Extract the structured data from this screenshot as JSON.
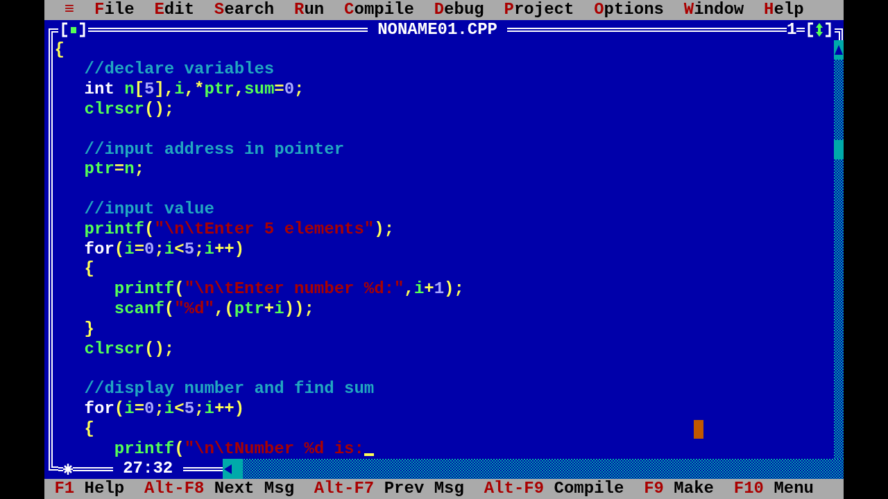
{
  "menu": {
    "system_menu": "≡",
    "items": [
      {
        "label": "File"
      },
      {
        "label": "Edit"
      },
      {
        "label": "Search"
      },
      {
        "label": "Run"
      },
      {
        "label": "Compile"
      },
      {
        "label": "Debug"
      },
      {
        "label": "Project"
      },
      {
        "label": "Options"
      },
      {
        "label": "Window"
      },
      {
        "label": "Help"
      }
    ]
  },
  "editor": {
    "title": "NONAME01.CPP",
    "number": "1",
    "modified": true,
    "cursor_position": "27:32",
    "lines": [
      {
        "kind": "code",
        "cursor": false,
        "tokens": [
          {
            "kind": "symbol",
            "text": "{"
          }
        ],
        "children": [
          {
            "kind": "code",
            "cursor": false,
            "tokens": [
              {
                "kind": "comment",
                "text": "//declare variables"
              }
            ]
          },
          {
            "kind": "code",
            "cursor": false,
            "tokens": [
              {
                "kind": "keyword",
                "text": "int"
              },
              {
                "kind": "space"
              },
              {
                "kind": "identifier",
                "text": "n"
              },
              {
                "kind": "symbol",
                "text": "["
              },
              {
                "kind": "number",
                "text": "5"
              },
              {
                "kind": "symbol",
                "text": "],"
              },
              {
                "kind": "identifier",
                "text": "i"
              },
              {
                "kind": "symbol",
                "text": ",*"
              },
              {
                "kind": "identifier",
                "text": "ptr"
              },
              {
                "kind": "symbol",
                "text": ","
              },
              {
                "kind": "identifier",
                "text": "sum"
              },
              {
                "kind": "symbol",
                "text": "="
              },
              {
                "kind": "number",
                "text": "0"
              },
              {
                "kind": "symbol",
                "text": ";"
              }
            ]
          },
          {
            "kind": "code",
            "cursor": false,
            "tokens": [
              {
                "kind": "identifier",
                "text": "clrscr"
              },
              {
                "kind": "symbol",
                "text": "();"
              }
            ]
          },
          {
            "kind": "blank"
          },
          {
            "kind": "code",
            "cursor": false,
            "tokens": [
              {
                "kind": "comment",
                "text": "//input address in pointer"
              }
            ]
          },
          {
            "kind": "code",
            "cursor": false,
            "tokens": [
              {
                "kind": "identifier",
                "text": "ptr"
              },
              {
                "kind": "symbol",
                "text": "="
              },
              {
                "kind": "identifier",
                "text": "n"
              },
              {
                "kind": "symbol",
                "text": ";"
              }
            ]
          },
          {
            "kind": "blank"
          },
          {
            "kind": "code",
            "cursor": false,
            "tokens": [
              {
                "kind": "comment",
                "text": "//input value"
              }
            ]
          },
          {
            "kind": "code",
            "cursor": false,
            "tokens": [
              {
                "kind": "identifier",
                "text": "printf"
              },
              {
                "kind": "symbol",
                "text": "("
              },
              {
                "kind": "string",
                "text": "\"\\n\\tEnter 5 elements\""
              },
              {
                "kind": "symbol",
                "text": ");"
              }
            ]
          },
          {
            "kind": "code",
            "cursor": false,
            "tokens": [
              {
                "kind": "keyword",
                "text": "for"
              },
              {
                "kind": "symbol",
                "text": "("
              },
              {
                "kind": "identifier",
                "text": "i"
              },
              {
                "kind": "symbol",
                "text": "="
              },
              {
                "kind": "number",
                "text": "0"
              },
              {
                "kind": "symbol",
                "text": ";"
              },
              {
                "kind": "identifier",
                "text": "i"
              },
              {
                "kind": "symbol",
                "text": "<"
              },
              {
                "kind": "number",
                "text": "5"
              },
              {
                "kind": "symbol",
                "text": ";"
              },
              {
                "kind": "identifier",
                "text": "i"
              },
              {
                "kind": "symbol",
                "text": "++)"
              }
            ]
          },
          {
            "kind": "code",
            "cursor": false,
            "tokens": [
              {
                "kind": "symbol",
                "text": "{"
              }
            ],
            "children": [
              {
                "kind": "code",
                "cursor": false,
                "tokens": [
                  {
                    "kind": "identifier",
                    "text": "printf"
                  },
                  {
                    "kind": "symbol",
                    "text": "("
                  },
                  {
                    "kind": "string",
                    "text": "\"\\n\\tEnter number %d:\""
                  },
                  {
                    "kind": "symbol",
                    "text": ","
                  },
                  {
                    "kind": "identifier",
                    "text": "i"
                  },
                  {
                    "kind": "symbol",
                    "text": "+"
                  },
                  {
                    "kind": "number",
                    "text": "1"
                  },
                  {
                    "kind": "symbol",
                    "text": ");"
                  }
                ]
              },
              {
                "kind": "code",
                "cursor": false,
                "tokens": [
                  {
                    "kind": "identifier",
                    "text": "scanf"
                  },
                  {
                    "kind": "symbol",
                    "text": "("
                  },
                  {
                    "kind": "string",
                    "text": "\"%d\""
                  },
                  {
                    "kind": "symbol",
                    "text": ",("
                  },
                  {
                    "kind": "identifier",
                    "text": "ptr"
                  },
                  {
                    "kind": "symbol",
                    "text": "+"
                  },
                  {
                    "kind": "identifier",
                    "text": "i"
                  },
                  {
                    "kind": "symbol",
                    "text": "));"
                  }
                ]
              }
            ]
          },
          {
            "kind": "code",
            "cursor": false,
            "tokens": [
              {
                "kind": "symbol",
                "text": "}"
              }
            ]
          },
          {
            "kind": "code",
            "cursor": false,
            "tokens": [
              {
                "kind": "identifier",
                "text": "clrscr"
              },
              {
                "kind": "symbol",
                "text": "();"
              }
            ]
          },
          {
            "kind": "blank"
          },
          {
            "kind": "code",
            "cursor": false,
            "tokens": [
              {
                "kind": "comment",
                "text": "//display number and find sum"
              }
            ]
          },
          {
            "kind": "code",
            "cursor": false,
            "tokens": [
              {
                "kind": "keyword",
                "text": "for"
              },
              {
                "kind": "symbol",
                "text": "("
              },
              {
                "kind": "identifier",
                "text": "i"
              },
              {
                "kind": "symbol",
                "text": "="
              },
              {
                "kind": "number",
                "text": "0"
              },
              {
                "kind": "symbol",
                "text": ";"
              },
              {
                "kind": "identifier",
                "text": "i"
              },
              {
                "kind": "symbol",
                "text": "<"
              },
              {
                "kind": "number",
                "text": "5"
              },
              {
                "kind": "symbol",
                "text": ";"
              },
              {
                "kind": "identifier",
                "text": "i"
              },
              {
                "kind": "symbol",
                "text": "++)"
              }
            ]
          },
          {
            "kind": "code",
            "cursor": false,
            "tokens": [
              {
                "kind": "symbol",
                "text": "{"
              }
            ],
            "children": [
              {
                "kind": "code",
                "cursor": true,
                "tokens": [
                  {
                    "kind": "identifier",
                    "text": "printf"
                  },
                  {
                    "kind": "symbol",
                    "text": "("
                  },
                  {
                    "kind": "string",
                    "text": "\"\\n\\tNumber %d is:"
                  }
                ]
              }
            ]
          }
        ]
      }
    ]
  },
  "status_bar": [
    {
      "key": "F1",
      "label": "Help"
    },
    {
      "key": "Alt-F8",
      "label": "Next Msg"
    },
    {
      "key": "Alt-F7",
      "label": "Prev Msg"
    },
    {
      "key": "Alt-F9",
      "label": "Compile"
    },
    {
      "key": "F9",
      "label": "Make"
    },
    {
      "key": "F10",
      "label": "Menu"
    }
  ]
}
